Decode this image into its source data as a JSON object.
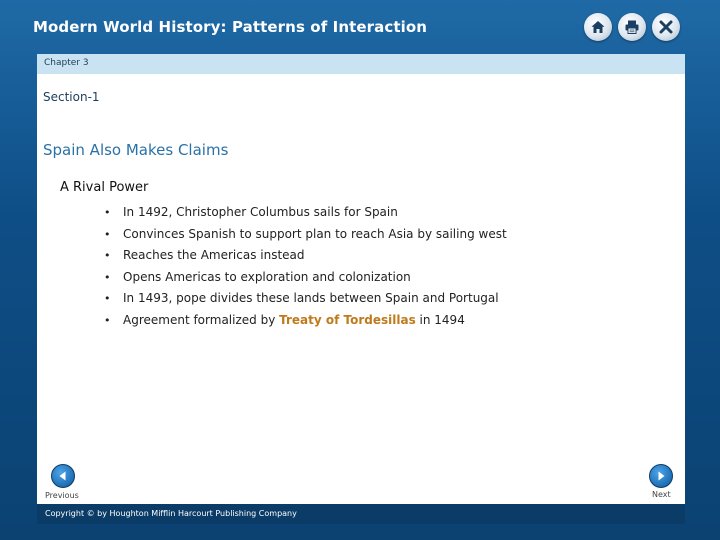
{
  "app": {
    "title": "Modern World History: Patterns of Interaction"
  },
  "toolbar": {
    "icons": [
      "home-icon",
      "print-icon",
      "close-icon"
    ]
  },
  "chapter": {
    "label": "Chapter 3"
  },
  "section": {
    "label": "Section-1"
  },
  "slide": {
    "title": "Spain Also Makes Claims",
    "subheading": "A Rival Power",
    "bullets": [
      {
        "text": "In 1492, Christopher Columbus sails for Spain"
      },
      {
        "text": "Convinces Spanish to support plan to reach Asia by sailing west"
      },
      {
        "text": "Reaches the Americas instead"
      },
      {
        "text": "Opens Americas to exploration and colonization"
      },
      {
        "text": "In 1493, pope divides these lands between Spain and Portugal"
      },
      {
        "text": "Agreement formalized by ",
        "highlight": "Treaty of Tordesillas",
        "after": " in 1494"
      }
    ]
  },
  "nav": {
    "previous_label": "Previous",
    "next_label": "Next"
  },
  "footer": {
    "copyright": "Copyright © by Houghton Mifflin Harcourt Publishing Company"
  },
  "colors": {
    "frame": "#0e4e86",
    "chapter_bar": "#c9e3f2",
    "title": "#2a71a8",
    "highlight": "#c07a1b",
    "nav_button": "#1e6fb5"
  }
}
